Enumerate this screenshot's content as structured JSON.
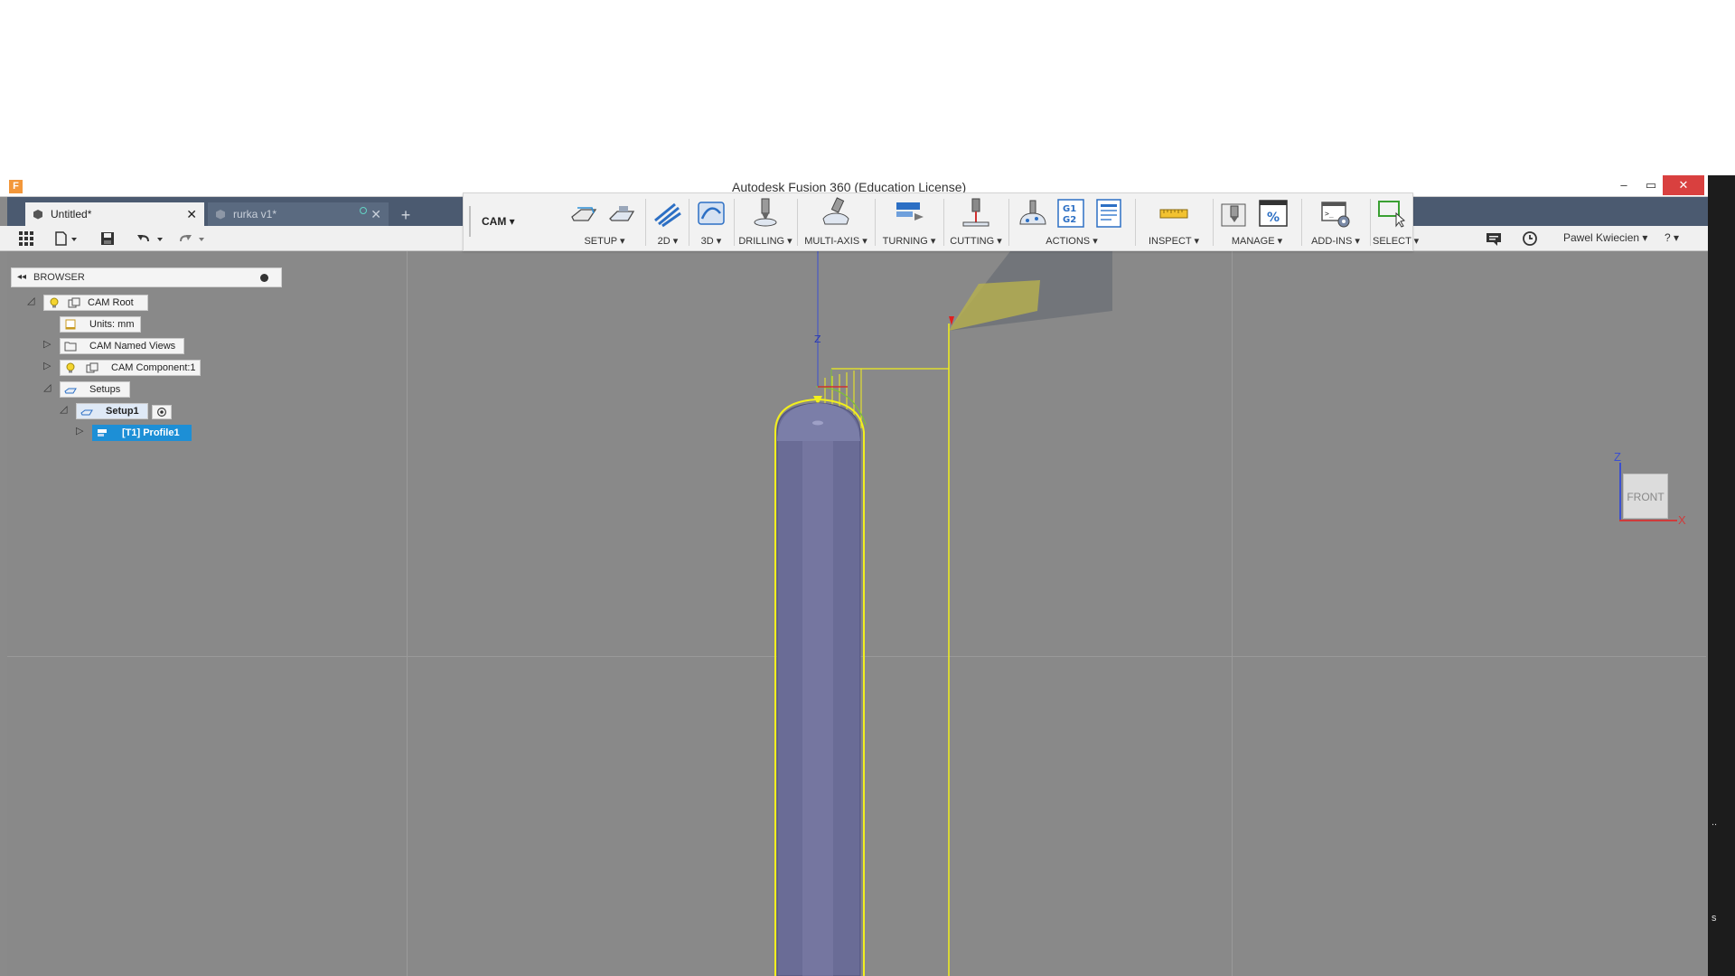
{
  "window": {
    "title": "Autodesk Fusion 360 (Education License)",
    "minimize": "–",
    "maximize": "▭",
    "close": "✕",
    "logo": "F"
  },
  "tabs": [
    {
      "label": "Untitled*",
      "close": "✕"
    },
    {
      "label": "rurka v1*",
      "close": "✕"
    }
  ],
  "new_tab": "+",
  "ribbon": {
    "workspace": "CAM ▾",
    "groups": [
      {
        "label": "SETUP ▾"
      },
      {
        "label": "2D ▾"
      },
      {
        "label": "3D ▾"
      },
      {
        "label": "DRILLING ▾"
      },
      {
        "label": "MULTI-AXIS ▾"
      },
      {
        "label": "TURNING ▾"
      },
      {
        "label": "CUTTING ▾"
      },
      {
        "label": "ACTIONS ▾"
      },
      {
        "label": "INSPECT ▾"
      },
      {
        "label": "MANAGE ▾"
      },
      {
        "label": "ADD-INS ▾"
      },
      {
        "label": "SELECT ▾"
      }
    ]
  },
  "toolbar": {
    "user": "Pawel Kwiecien ▾",
    "help": "? ▾"
  },
  "browser": {
    "header": "BROWSER",
    "items": [
      {
        "label": "CAM Root"
      },
      {
        "label": "Units: mm"
      },
      {
        "label": "CAM Named Views"
      },
      {
        "label": "CAM Component:1"
      },
      {
        "label": "Setups"
      },
      {
        "label": "Setup1"
      },
      {
        "label": "[T1] Profile1"
      }
    ]
  },
  "viewcube": {
    "face": "FRONT",
    "z_label": "Z",
    "x_label": "X"
  },
  "axis_label_z": "Z",
  "right_strip": {
    "mark1": "..",
    "mark2": "s"
  },
  "colors": {
    "viewport_bg": "#898989",
    "part_fill": "#6a6c96",
    "toolpath": "#f2ef1d",
    "tool_insert": "#b8b24e",
    "tab_bar": "#4b5a70",
    "selected": "#1d8fd6"
  }
}
